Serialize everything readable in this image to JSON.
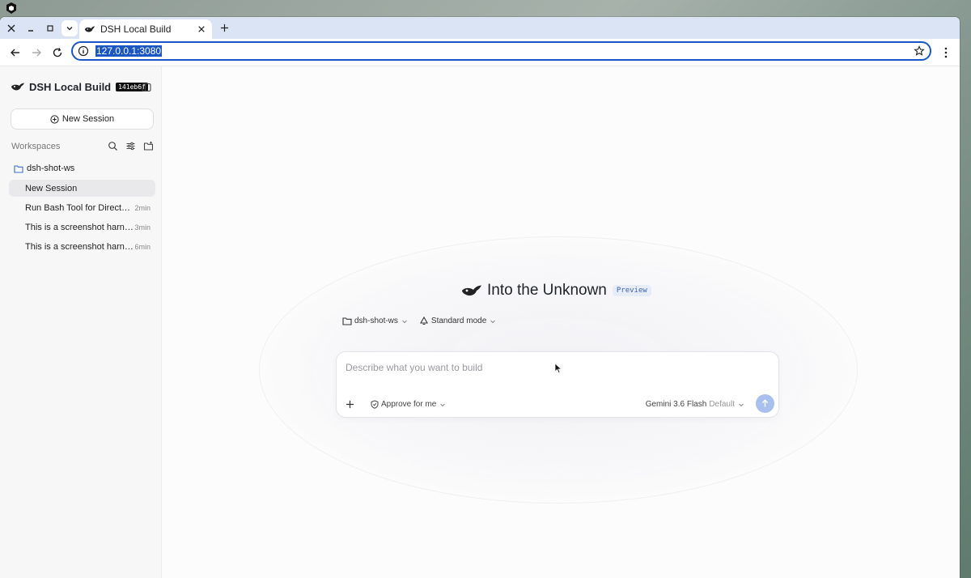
{
  "browser": {
    "tab_title": "DSH Local Build",
    "url": "127.0.0.1:3080"
  },
  "sidebar": {
    "brand_name": "DSH Local Build",
    "build_badge": "141eb6f",
    "new_session_label": "New Session",
    "workspaces_label": "Workspaces",
    "workspace_name": "dsh-shot-ws",
    "sessions": [
      {
        "title": "New Session",
        "time": ""
      },
      {
        "title": "Run Bash Tool for Director...",
        "time": "2min"
      },
      {
        "title": "This is a screenshot harne...",
        "time": "3min"
      },
      {
        "title": "This is a screenshot harne...",
        "time": "6min"
      }
    ]
  },
  "main": {
    "hero_title": "Into the Unknown",
    "preview_badge": "Preview",
    "workspace_selector": "dsh-shot-ws",
    "mode_selector": "Standard mode",
    "prompt_placeholder": "Describe what you want to build",
    "approval_selector": "Approve for me",
    "model_name": "Gemini 3.6 Flash",
    "model_default": "Default"
  },
  "icons": {
    "accent": "#1a56c4",
    "send_color": "#a9c0ee"
  }
}
